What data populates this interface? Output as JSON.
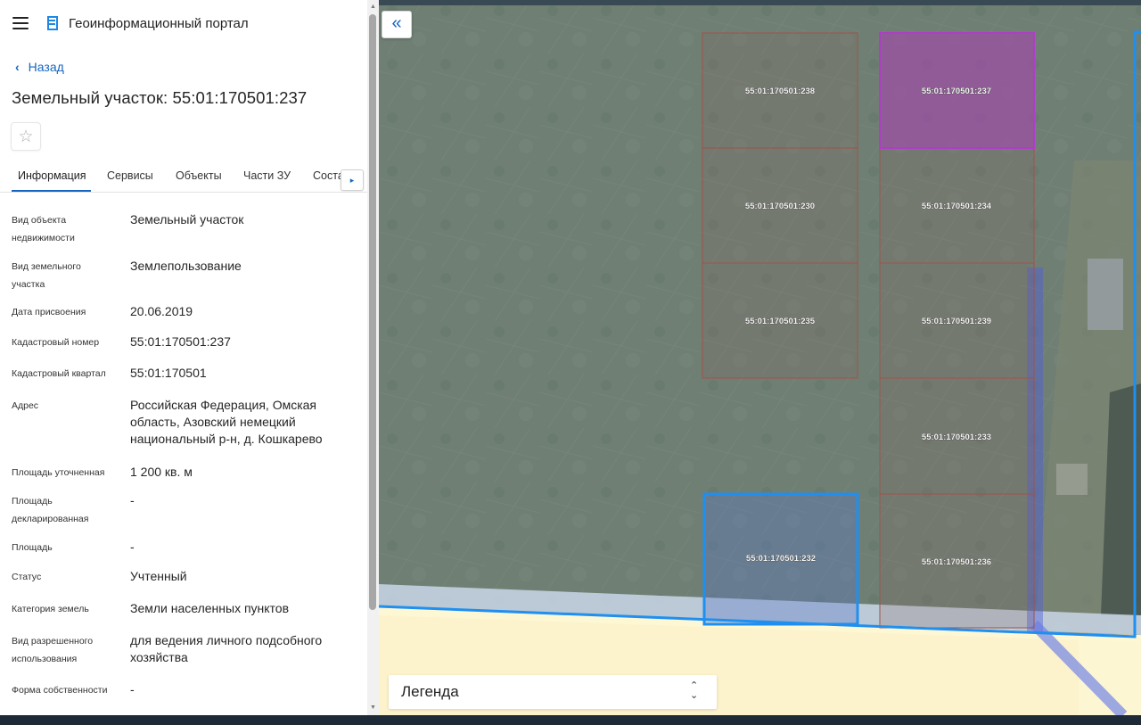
{
  "header": {
    "app_title": "Геоинформационный портал",
    "menu_icon": "hamburger-icon",
    "logo_icon": "portal-logo-icon"
  },
  "nav": {
    "back_label": "Назад",
    "back_icon": "chevron-left-icon"
  },
  "page_title": "Земельный участок: 55:01:170501:237",
  "favorite_icon": "☆",
  "tabs": [
    {
      "label": "Информация",
      "active": true
    },
    {
      "label": "Сервисы"
    },
    {
      "label": "Объекты"
    },
    {
      "label": "Части ЗУ"
    },
    {
      "label": "Соста"
    }
  ],
  "tab_scroll_icon": "▸",
  "info": [
    {
      "label": "Вид объекта недвижимости",
      "value": "Земельный участок"
    },
    {
      "label": "Вид земельного участка",
      "value": "Землепользование"
    },
    {
      "label": "Дата присвоения",
      "value": "20.06.2019"
    },
    {
      "label": "Кадастровый номер",
      "value": "55:01:170501:237"
    },
    {
      "label": "Кадастровый квартал",
      "value": "55:01:170501"
    },
    {
      "label": "Адрес",
      "value": "Российская Федерация, Омская область, Азовский немецкий национальный р-н, д. Кошкарево"
    },
    {
      "label": "Площадь уточненная",
      "value": "1 200 кв. м"
    },
    {
      "label": "Площадь декларированная",
      "value": "-"
    },
    {
      "label": "Площадь",
      "value": "-"
    },
    {
      "label": "Статус",
      "value": "Учтенный"
    },
    {
      "label": "Категория земель",
      "value": "Земли населенных пунктов"
    },
    {
      "label": "Вид разрешенного использования",
      "value": "для ведения личного подсобного хозяйства"
    },
    {
      "label": "Форма собственности",
      "value": "-"
    }
  ],
  "map": {
    "collapse_icon": "«",
    "parcels": [
      {
        "id": "55:01:170501:238"
      },
      {
        "id": "55:01:170501:237",
        "selected": true
      },
      {
        "id": "55:01:170501:230"
      },
      {
        "id": "55:01:170501:234"
      },
      {
        "id": "55:01:170501:235"
      },
      {
        "id": "55:01:170501:239"
      },
      {
        "id": "55:01:170501:233"
      },
      {
        "id": "55:01:170501:232",
        "highlighted": true
      },
      {
        "id": "55:01:170501:236"
      }
    ],
    "legend_label": "Легенда",
    "legend_icon": "sort-arrows-icon",
    "colors": {
      "selected_fill": "#9b4fa3",
      "selected_stroke": "#b03cc8",
      "outline_blue": "#1f8ff0",
      "parcel_stroke": "#a0524a"
    }
  }
}
